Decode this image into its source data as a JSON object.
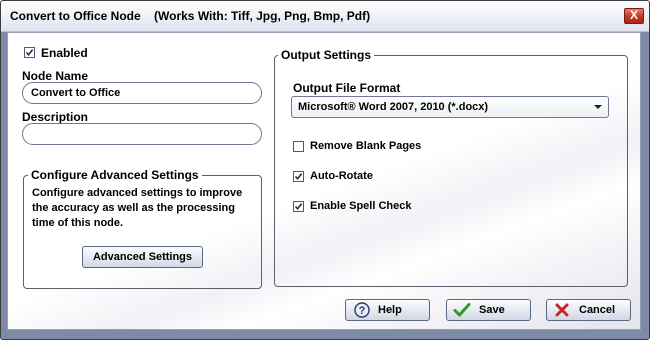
{
  "window": {
    "title": "Convert to Office Node",
    "subtitle": "(Works With: Tiff, Jpg, Png, Bmp, Pdf)",
    "close_label": "X"
  },
  "left": {
    "enabled_label": "Enabled",
    "enabled_checked": true,
    "node_name_label": "Node Name",
    "node_name_value": "Convert to Office",
    "description_label": "Description",
    "description_value": ""
  },
  "advanced": {
    "legend": "Configure Advanced Settings",
    "text": "Configure advanced settings to improve the accuracy as well as the processing time of this node.",
    "button_label": "Advanced Settings"
  },
  "output": {
    "legend": "Output Settings",
    "format_label": "Output File Format",
    "format_value": "Microsoft® Word 2007, 2010 (*.docx)",
    "options": [
      {
        "label": "Remove Blank Pages",
        "checked": false
      },
      {
        "label": "Auto-Rotate",
        "checked": true
      },
      {
        "label": "Enable Spell Check",
        "checked": true
      }
    ]
  },
  "footer": {
    "help_label": "Help",
    "save_label": "Save",
    "cancel_label": "Cancel"
  }
}
